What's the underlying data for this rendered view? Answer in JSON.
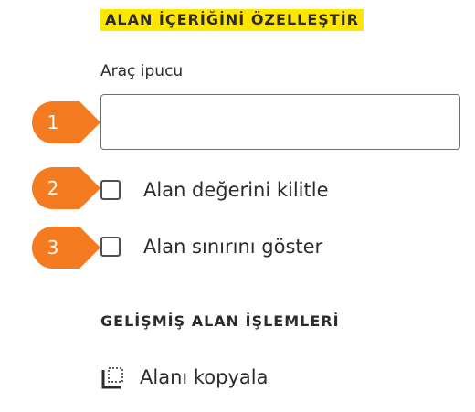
{
  "section": {
    "title": "ALAN İÇERİĞİNİ ÖZELLEŞTİR"
  },
  "tooltip": {
    "label": "Araç ipucu",
    "value": ""
  },
  "options": [
    {
      "label": "Alan değerini kilitle",
      "checked": false
    },
    {
      "label": "Alan sınırını göster",
      "checked": false
    }
  ],
  "callouts": {
    "color": "#f47b20",
    "items": [
      "1",
      "2",
      "3"
    ]
  },
  "advanced": {
    "title": "GELİŞMİŞ ALAN İŞLEMLERİ",
    "actions": [
      {
        "label": "Alanı kopyala",
        "icon": "copy-field-icon"
      }
    ]
  }
}
